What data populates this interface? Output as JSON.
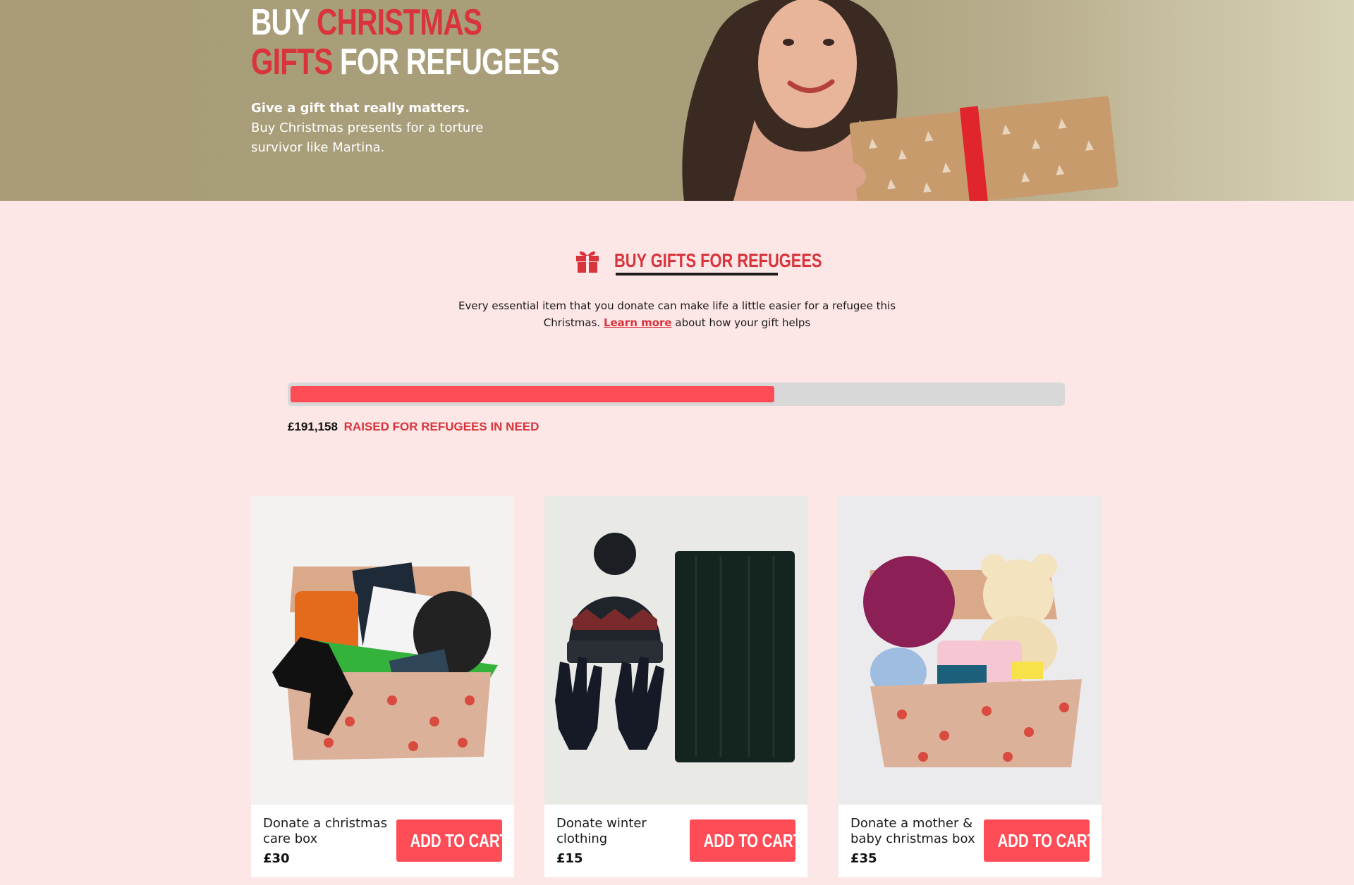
{
  "hero": {
    "title_line1_white": "BUY",
    "title_line1_red": "CHRISTMAS",
    "title_line2_red": "GIFTS",
    "title_line2_white": "FOR REFUGEES",
    "subtitle_bold": "Give a gift that really matters.",
    "subtitle": "Buy Christmas presents for a torture survivor like Martina."
  },
  "section": {
    "icon": "gift-icon",
    "title": "BUY GIFTS FOR REFUGEES",
    "intro_before": "Every essential item that you donate can make life a little easier for a refugee this Christmas.",
    "learn_more": "Learn more",
    "intro_after": "about how your gift helps"
  },
  "progress": {
    "fraction": 0.627,
    "amount": "£191,158",
    "label": "RAISED FOR REFUGEES IN NEED"
  },
  "products": [
    {
      "name": "Donate a christmas care box",
      "price": "£30",
      "button": "ADD TO CART"
    },
    {
      "name": "Donate winter clothing",
      "price": "£15",
      "button": "ADD TO CART"
    },
    {
      "name": "Donate a mother & baby christmas box",
      "price": "£35",
      "button": "ADD TO CART"
    }
  ],
  "colors": {
    "accent": "#ff4d57",
    "brand_red": "#d9343c",
    "page_bg": "#fde6e6"
  }
}
